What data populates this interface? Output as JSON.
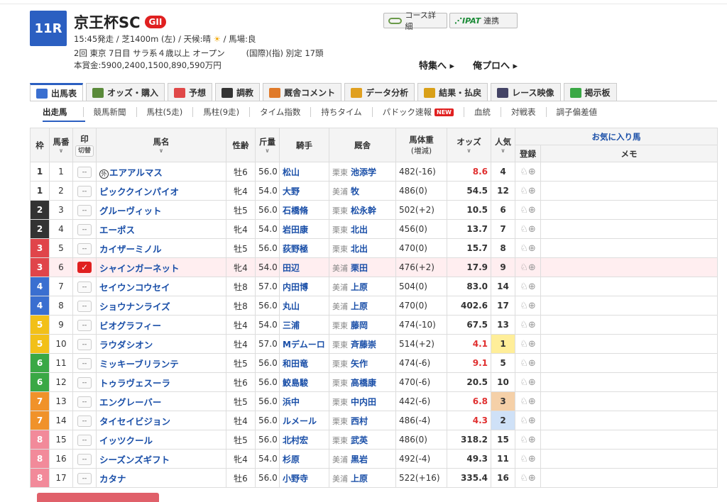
{
  "race": {
    "number": "11R",
    "name": "京王杯SC",
    "grade": "GII",
    "meta1_pre": "15:45発走 / 芝1400m (左) / 天候:晴",
    "weather_icon": "sun-icon",
    "meta1_post": "/ 馬場:良",
    "meta2_a": "2回 東京 7日目 サラ系４歳以上 オープン",
    "meta2_b": "(国際)(指) 別定 17頭",
    "prize": "本賞金:5900,2400,1500,890,590万円"
  },
  "buttons": {
    "course": "コース詳細",
    "ipat_logo": "IPAT",
    "ipat": "連携",
    "toku": "特集へ ▸",
    "ore": "俺プロへ ▸"
  },
  "tabs": [
    {
      "label": "出馬表",
      "icon": "table-icon"
    },
    {
      "label": "オッズ・購入",
      "icon": "odds-icon"
    },
    {
      "label": "予想",
      "icon": "target-icon"
    },
    {
      "label": "調教",
      "icon": "stopwatch-icon"
    },
    {
      "label": "厩舎コメント",
      "icon": "stable-icon"
    },
    {
      "label": "データ分析",
      "icon": "chart-icon"
    },
    {
      "label": "結果・払戻",
      "icon": "coins-icon"
    },
    {
      "label": "レース映像",
      "icon": "video-icon"
    },
    {
      "label": "掲示板",
      "icon": "chat-icon"
    }
  ],
  "subnav": [
    "出走馬",
    "競馬新聞",
    "馬柱(5走)",
    "馬柱(9走)",
    "タイム指数",
    "持ちタイム",
    "パドック速報",
    "血統",
    "対戦表",
    "調子偏差値"
  ],
  "new_badge": "NEW",
  "headers": {
    "waku": "枠",
    "umaban": "馬番",
    "mark": "印",
    "mark_toggle": "切替",
    "name": "馬名",
    "sexage": "性齢",
    "weight": "斤量",
    "jockey": "騎手",
    "trainer": "厩舎",
    "body": "馬体重",
    "body_sub": "(増減)",
    "odds": "オッズ",
    "pop": "人気",
    "fav": "お気に入り馬",
    "reg": "登録",
    "memo": "メモ"
  },
  "gai_label": "外",
  "mark_empty": "--",
  "mark_checked": "✓",
  "rows": [
    {
      "waku": "1",
      "wcolor": "#ffffff",
      "wtext": "#333333",
      "no": "1",
      "gai": true,
      "name": "エアアルマス",
      "sex": "牡6",
      "wt": "56.0",
      "jockey": "松山",
      "area": "栗東",
      "trainer": "池添学",
      "body": "482(-16)",
      "odds": "8.6",
      "hot": true,
      "pop": "4"
    },
    {
      "waku": "1",
      "wcolor": "#ffffff",
      "wtext": "#333333",
      "no": "2",
      "gai": false,
      "name": "ピッククインパイオ",
      "sex": "牝4",
      "wt": "54.0",
      "jockey": "大野",
      "area": "美浦",
      "trainer": "牧",
      "body": "486(0)",
      "odds": "54.5",
      "hot": false,
      "pop": "12"
    },
    {
      "waku": "2",
      "wcolor": "#333333",
      "wtext": "#ffffff",
      "no": "3",
      "gai": false,
      "name": "グルーヴィット",
      "sex": "牡5",
      "wt": "56.0",
      "jockey": "石橋脩",
      "area": "栗東",
      "trainer": "松永幹",
      "body": "502(+2)",
      "odds": "10.5",
      "hot": false,
      "pop": "6"
    },
    {
      "waku": "2",
      "wcolor": "#333333",
      "wtext": "#ffffff",
      "no": "4",
      "gai": false,
      "name": "エーポス",
      "sex": "牝4",
      "wt": "54.0",
      "jockey": "岩田康",
      "area": "栗東",
      "trainer": "北出",
      "body": "456(0)",
      "odds": "13.7",
      "hot": false,
      "pop": "7"
    },
    {
      "waku": "3",
      "wcolor": "#e0454a",
      "wtext": "#ffffff",
      "no": "5",
      "gai": false,
      "name": "カイザーミノル",
      "sex": "牡5",
      "wt": "56.0",
      "jockey": "荻野極",
      "area": "栗東",
      "trainer": "北出",
      "body": "470(0)",
      "odds": "15.7",
      "hot": false,
      "pop": "8"
    },
    {
      "waku": "3",
      "wcolor": "#e0454a",
      "wtext": "#ffffff",
      "no": "6",
      "gai": false,
      "checked": true,
      "name": "シャインガーネット",
      "sex": "牝4",
      "wt": "54.0",
      "jockey": "田辺",
      "area": "美浦",
      "trainer": "栗田",
      "body": "476(+2)",
      "odds": "17.9",
      "hot": false,
      "pop": "9"
    },
    {
      "waku": "4",
      "wcolor": "#3a6fd0",
      "wtext": "#ffffff",
      "no": "7",
      "gai": false,
      "name": "セイウンコウセイ",
      "sex": "牡8",
      "wt": "57.0",
      "jockey": "内田博",
      "area": "美浦",
      "trainer": "上原",
      "body": "504(0)",
      "odds": "83.0",
      "hot": false,
      "pop": "14"
    },
    {
      "waku": "4",
      "wcolor": "#3a6fd0",
      "wtext": "#ffffff",
      "no": "8",
      "gai": false,
      "name": "ショウナンライズ",
      "sex": "牡8",
      "wt": "56.0",
      "jockey": "丸山",
      "area": "美浦",
      "trainer": "上原",
      "body": "470(0)",
      "odds": "402.6",
      "hot": false,
      "pop": "17"
    },
    {
      "waku": "5",
      "wcolor": "#f2c018",
      "wtext": "#ffffff",
      "no": "9",
      "gai": false,
      "name": "ビオグラフィー",
      "sex": "牡4",
      "wt": "54.0",
      "jockey": "三浦",
      "area": "栗東",
      "trainer": "藤岡",
      "body": "474(-10)",
      "odds": "67.5",
      "hot": false,
      "pop": "13"
    },
    {
      "waku": "5",
      "wcolor": "#f2c018",
      "wtext": "#ffffff",
      "no": "10",
      "gai": false,
      "name": "ラウダシオン",
      "sex": "牡4",
      "wt": "57.0",
      "jockey": "Mデムーロ",
      "area": "栗東",
      "trainer": "斉藤崇",
      "body": "514(+2)",
      "odds": "4.1",
      "hot": true,
      "pop": "1",
      "pcls": "p1"
    },
    {
      "waku": "6",
      "wcolor": "#3aa845",
      "wtext": "#ffffff",
      "no": "11",
      "gai": false,
      "name": "ミッキーブリランテ",
      "sex": "牡5",
      "wt": "56.0",
      "jockey": "和田竜",
      "area": "栗東",
      "trainer": "矢作",
      "body": "474(-6)",
      "odds": "9.1",
      "hot": true,
      "pop": "5"
    },
    {
      "waku": "6",
      "wcolor": "#3aa845",
      "wtext": "#ffffff",
      "no": "12",
      "gai": false,
      "name": "トゥラヴェスーラ",
      "sex": "牡6",
      "wt": "56.0",
      "jockey": "鮫島駿",
      "area": "栗東",
      "trainer": "高橋康",
      "body": "470(-6)",
      "odds": "20.5",
      "hot": false,
      "pop": "10"
    },
    {
      "waku": "7",
      "wcolor": "#f0922a",
      "wtext": "#ffffff",
      "no": "13",
      "gai": false,
      "name": "エングレーバー",
      "sex": "牡5",
      "wt": "56.0",
      "jockey": "浜中",
      "area": "栗東",
      "trainer": "中内田",
      "body": "442(-6)",
      "odds": "6.8",
      "hot": true,
      "pop": "3",
      "pcls": "p3"
    },
    {
      "waku": "7",
      "wcolor": "#f0922a",
      "wtext": "#ffffff",
      "no": "14",
      "gai": false,
      "name": "タイセイビジョン",
      "sex": "牡4",
      "wt": "56.0",
      "jockey": "ルメール",
      "area": "栗東",
      "trainer": "西村",
      "body": "486(-4)",
      "odds": "4.3",
      "hot": true,
      "pop": "2",
      "pcls": "p2"
    },
    {
      "waku": "8",
      "wcolor": "#f28a9a",
      "wtext": "#ffffff",
      "no": "15",
      "gai": false,
      "name": "イッツクール",
      "sex": "牡5",
      "wt": "56.0",
      "jockey": "北村宏",
      "area": "栗東",
      "trainer": "武英",
      "body": "486(0)",
      "odds": "318.2",
      "hot": false,
      "pop": "15"
    },
    {
      "waku": "8",
      "wcolor": "#f28a9a",
      "wtext": "#ffffff",
      "no": "16",
      "gai": false,
      "name": "シーズンズギフト",
      "sex": "牝4",
      "wt": "54.0",
      "jockey": "杉原",
      "area": "美浦",
      "trainer": "黒岩",
      "body": "492(-4)",
      "odds": "49.3",
      "hot": false,
      "pop": "11"
    },
    {
      "waku": "8",
      "wcolor": "#f28a9a",
      "wtext": "#ffffff",
      "no": "17",
      "gai": false,
      "name": "カタナ",
      "sex": "牡6",
      "wt": "56.0",
      "jockey": "小野寺",
      "area": "美浦",
      "trainer": "上原",
      "body": "522(+16)",
      "odds": "335.4",
      "hot": false,
      "pop": "16"
    }
  ]
}
